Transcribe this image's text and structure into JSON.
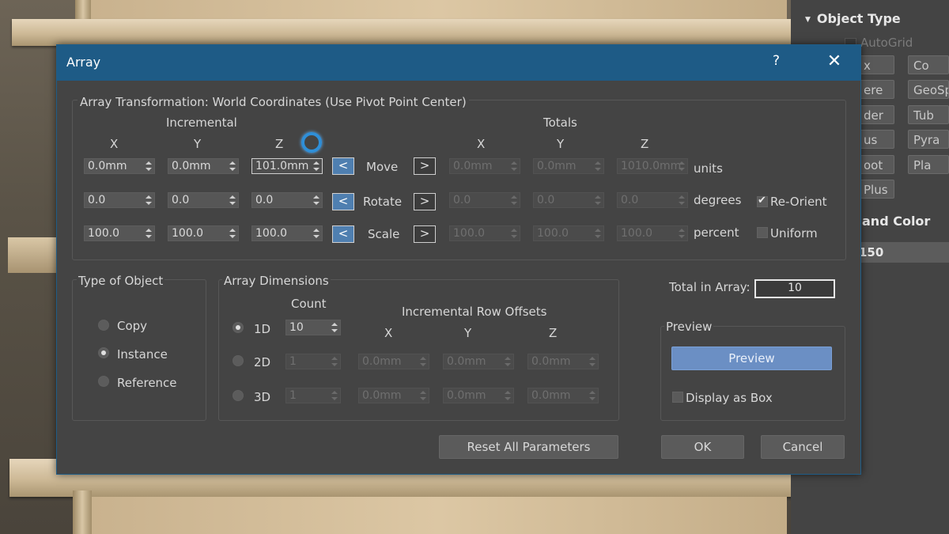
{
  "command_panel": {
    "object_type_title": "Object Type",
    "autogrid_label": "AutoGrid",
    "buttons": [
      "x",
      "Co",
      "ere",
      "GeoSp",
      "der",
      "Tub",
      "us",
      "Pyra",
      "oot",
      "Pla",
      "Plus"
    ],
    "name_color_title": "and Color",
    "name_value": "150"
  },
  "dialog": {
    "title": "Array",
    "help": "?",
    "close": "✕",
    "transform_group_title": "Array Transformation: World Coordinates (Use Pivot Point Center)",
    "incremental_label": "Incremental",
    "totals_label": "Totals",
    "axis": {
      "x": "X",
      "y": "Y",
      "z": "Z"
    },
    "move": {
      "label": "Move",
      "inc": [
        "0.0mm",
        "0.0mm",
        "101.0mm"
      ],
      "tot": [
        "0.0mm",
        "0.0mm",
        "1010.0mm"
      ],
      "unit": "units"
    },
    "rotate": {
      "label": "Rotate",
      "inc": [
        "0.0",
        "0.0",
        "0.0"
      ],
      "tot": [
        "0.0",
        "0.0",
        "0.0"
      ],
      "unit": "degrees",
      "reorient_label": "Re-Orient",
      "reorient_checked": true
    },
    "scale": {
      "label": "Scale",
      "inc": [
        "100.0",
        "100.0",
        "100.0"
      ],
      "tot": [
        "100.0",
        "100.0",
        "100.0"
      ],
      "unit": "percent",
      "uniform_label": "Uniform",
      "uniform_checked": false
    },
    "arrow_left": "<",
    "arrow_right": ">",
    "type_of_object": {
      "title": "Type of Object",
      "options": [
        "Copy",
        "Instance",
        "Reference"
      ],
      "selected": "Instance"
    },
    "array_dimensions": {
      "title": "Array Dimensions",
      "count_label": "Count",
      "row_offsets_label": "Incremental Row Offsets",
      "rows": [
        {
          "label": "1D",
          "count": "10",
          "x": "",
          "y": "",
          "z": ""
        },
        {
          "label": "2D",
          "count": "1",
          "x": "0.0mm",
          "y": "0.0mm",
          "z": "0.0mm"
        },
        {
          "label": "3D",
          "count": "1",
          "x": "0.0mm",
          "y": "0.0mm",
          "z": "0.0mm"
        }
      ],
      "selected": "1D"
    },
    "total_in_array": {
      "label": "Total in Array:",
      "value": "10"
    },
    "preview": {
      "title": "Preview",
      "button": "Preview",
      "display_as_box_label": "Display as Box",
      "display_as_box_checked": false
    },
    "reset_button": "Reset All Parameters",
    "ok_button": "OK",
    "cancel_button": "Cancel"
  }
}
